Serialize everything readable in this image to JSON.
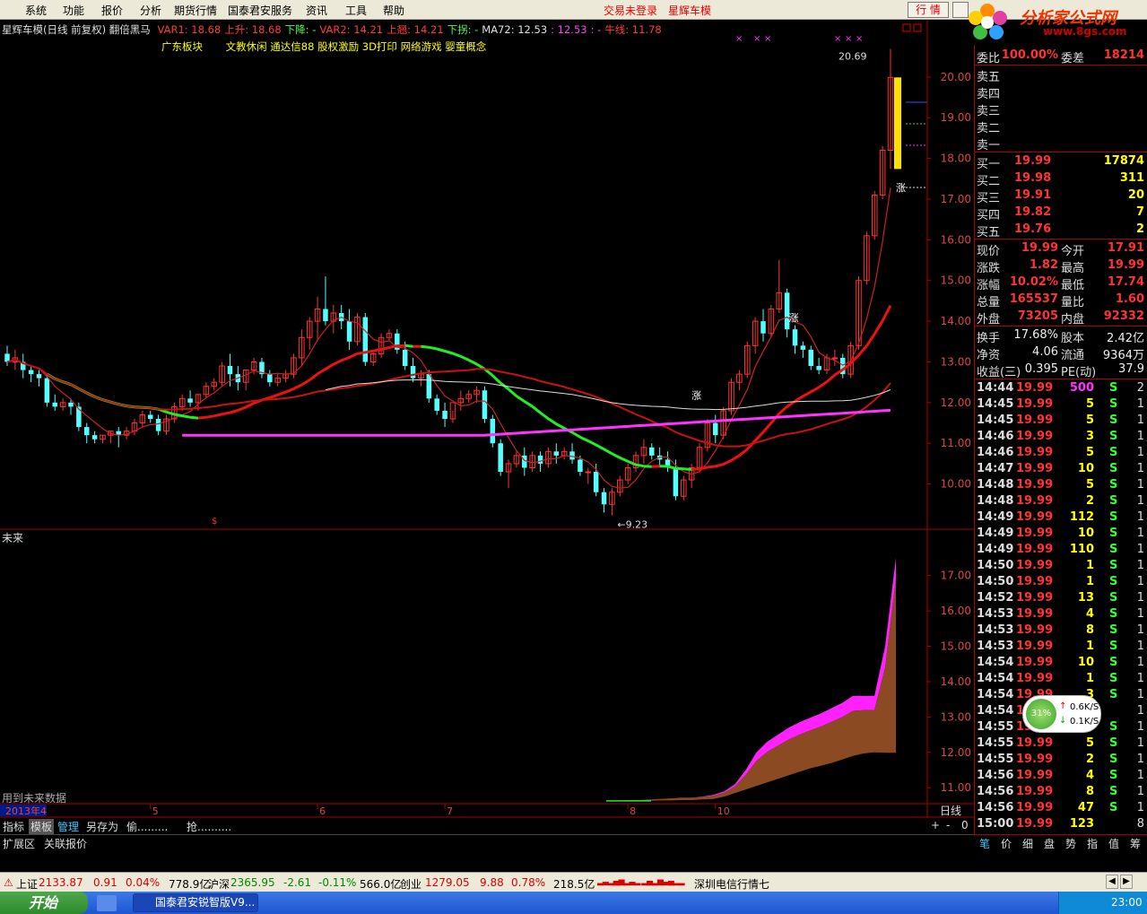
{
  "menu": [
    "系统",
    "功能",
    "报价",
    "分析",
    "期货行情",
    "国泰君安服务",
    "资讯",
    "工具",
    "帮助"
  ],
  "trade_status": "交易未登录",
  "stock_name": "星辉车模",
  "top_buttons": [
    "行 情"
  ],
  "logo": {
    "text": "分析家公式网",
    "url": "www.8gs.com"
  },
  "info": {
    "title": "星辉车模(日线 前复权) 翻倍黑马",
    "items": [
      {
        "label": "VAR1:",
        "value": "18.68",
        "color": "#ff3b3b"
      },
      {
        "label": "上升:",
        "value": "18.68",
        "color": "#ff3b3b"
      },
      {
        "label": "下降:",
        "value": "-",
        "color": "#4cff4c"
      },
      {
        "label": "VAR2:",
        "value": "14.21",
        "color": "#ff3b3b"
      },
      {
        "label": "上翘:",
        "value": "14.21",
        "color": "#ff3b3b"
      },
      {
        "label": "下拐:",
        "value": "-",
        "color": "#4cff4c"
      },
      {
        "label": "MA72:",
        "value": "12.53",
        "color": "#e0e0e0"
      },
      {
        "label": ":",
        "value": "12.53",
        "color": "#ff40ff"
      },
      {
        "label": ":",
        "value": "-",
        "color": "#ff40ff"
      },
      {
        "label": "牛线:",
        "value": "11.78",
        "color": "#ff3b3b"
      }
    ],
    "sector_label": "广东板块",
    "concepts": "文教休闲 通达信88 股权激励 3D打印 网络游戏 婴童概念"
  },
  "chart_data": {
    "type": "candlestick",
    "title": "星辉车模(日线 前复权)",
    "main_ylim": [
      9.0,
      20.9
    ],
    "main_ticks": [
      "20.00",
      "19.00",
      "18.00",
      "17.00",
      "16.00",
      "15.00",
      "14.00",
      "13.00",
      "12.00",
      "11.00",
      "10.00"
    ],
    "sub_ylim": [
      10.6,
      17.5
    ],
    "sub_ticks": [
      "17.00",
      "16.00",
      "15.00",
      "14.00",
      "13.00",
      "12.00",
      "11.00"
    ],
    "sub_title": "未来",
    "sub_note": "用到未来数据",
    "x_axis_labels": [
      {
        "label": "2013年4",
        "index": 0
      },
      {
        "label": "5",
        "index": 18
      },
      {
        "label": "6",
        "index": 39
      },
      {
        "label": "7",
        "index": 55
      },
      {
        "label": "8",
        "index": 78
      },
      {
        "label": "10",
        "index": 89
      }
    ],
    "period_label": "日线",
    "annotations": {
      "high": "20.69",
      "low": "9.23",
      "up_mark": "涨"
    },
    "candles": [
      {
        "o": 13.2,
        "h": 13.4,
        "c": 13.0,
        "l": 12.9
      },
      {
        "o": 13.0,
        "h": 13.3,
        "c": 13.1,
        "l": 12.8
      },
      {
        "o": 13.0,
        "h": 13.2,
        "c": 12.8,
        "l": 12.6
      },
      {
        "o": 12.8,
        "h": 12.9,
        "c": 12.7,
        "l": 12.5
      },
      {
        "o": 12.7,
        "h": 12.8,
        "c": 12.6,
        "l": 12.4
      },
      {
        "o": 12.6,
        "h": 12.7,
        "c": 12.0,
        "l": 11.9
      },
      {
        "o": 12.0,
        "h": 12.2,
        "c": 11.9,
        "l": 11.8
      },
      {
        "o": 11.9,
        "h": 12.1,
        "c": 12.0,
        "l": 11.8
      },
      {
        "o": 12.0,
        "h": 12.1,
        "c": 11.9,
        "l": 11.7
      },
      {
        "o": 11.9,
        "h": 12.0,
        "c": 11.4,
        "l": 11.3
      },
      {
        "o": 11.4,
        "h": 11.5,
        "c": 11.2,
        "l": 11.0
      },
      {
        "o": 11.2,
        "h": 11.3,
        "c": 11.1,
        "l": 11.0
      },
      {
        "o": 11.1,
        "h": 11.2,
        "c": 11.2,
        "l": 11.0
      },
      {
        "o": 11.2,
        "h": 11.3,
        "c": 11.3,
        "l": 11.0
      },
      {
        "o": 11.3,
        "h": 11.4,
        "c": 11.2,
        "l": 10.9
      },
      {
        "o": 11.2,
        "h": 11.4,
        "c": 11.3,
        "l": 11.1
      },
      {
        "o": 11.3,
        "h": 11.6,
        "c": 11.5,
        "l": 11.2
      },
      {
        "o": 11.5,
        "h": 11.8,
        "c": 11.7,
        "l": 11.4
      },
      {
        "o": 11.7,
        "h": 11.8,
        "c": 11.6,
        "l": 11.5
      },
      {
        "o": 11.6,
        "h": 11.7,
        "c": 11.3,
        "l": 11.2
      },
      {
        "o": 11.3,
        "h": 11.7,
        "c": 11.6,
        "l": 11.2
      },
      {
        "o": 11.6,
        "h": 12.0,
        "c": 11.9,
        "l": 11.5
      },
      {
        "o": 11.9,
        "h": 12.2,
        "c": 12.1,
        "l": 11.8
      },
      {
        "o": 12.1,
        "h": 12.3,
        "c": 12.0,
        "l": 11.9
      },
      {
        "o": 12.0,
        "h": 12.2,
        "c": 12.2,
        "l": 11.8
      },
      {
        "o": 12.2,
        "h": 12.5,
        "c": 12.4,
        "l": 12.1
      },
      {
        "o": 12.4,
        "h": 12.6,
        "c": 12.5,
        "l": 12.3
      },
      {
        "o": 12.5,
        "h": 13.0,
        "c": 12.9,
        "l": 12.4
      },
      {
        "o": 12.9,
        "h": 13.2,
        "c": 12.7,
        "l": 12.4
      },
      {
        "o": 12.7,
        "h": 12.9,
        "c": 12.5,
        "l": 12.3
      },
      {
        "o": 12.5,
        "h": 12.8,
        "c": 12.8,
        "l": 12.3
      },
      {
        "o": 12.8,
        "h": 13.1,
        "c": 13.0,
        "l": 12.7
      },
      {
        "o": 13.0,
        "h": 13.1,
        "c": 12.7,
        "l": 12.6
      },
      {
        "o": 12.7,
        "h": 12.8,
        "c": 12.5,
        "l": 12.4
      },
      {
        "o": 12.5,
        "h": 12.7,
        "c": 12.6,
        "l": 12.4
      },
      {
        "o": 12.6,
        "h": 12.8,
        "c": 12.7,
        "l": 12.5
      },
      {
        "o": 12.7,
        "h": 13.2,
        "c": 13.1,
        "l": 12.6
      },
      {
        "o": 13.1,
        "h": 13.8,
        "c": 13.6,
        "l": 12.9
      },
      {
        "o": 13.6,
        "h": 14.1,
        "c": 14.0,
        "l": 13.3
      },
      {
        "o": 14.0,
        "h": 14.6,
        "c": 14.3,
        "l": 13.5
      },
      {
        "o": 14.3,
        "h": 15.1,
        "c": 14.0,
        "l": 13.9
      },
      {
        "o": 14.0,
        "h": 14.4,
        "c": 14.2,
        "l": 13.7
      },
      {
        "o": 14.2,
        "h": 14.4,
        "c": 14.0,
        "l": 13.8
      },
      {
        "o": 14.0,
        "h": 14.3,
        "c": 13.5,
        "l": 13.3
      },
      {
        "o": 13.5,
        "h": 14.2,
        "c": 14.1,
        "l": 13.4
      },
      {
        "o": 14.1,
        "h": 14.2,
        "c": 13.0,
        "l": 12.9
      },
      {
        "o": 13.0,
        "h": 13.3,
        "c": 13.2,
        "l": 12.9
      },
      {
        "o": 13.2,
        "h": 13.7,
        "c": 13.6,
        "l": 13.1
      },
      {
        "o": 13.6,
        "h": 13.8,
        "c": 13.7,
        "l": 13.5
      },
      {
        "o": 13.7,
        "h": 13.8,
        "c": 13.3,
        "l": 13.2
      },
      {
        "o": 13.3,
        "h": 13.5,
        "c": 12.9,
        "l": 12.8
      },
      {
        "o": 12.9,
        "h": 13.1,
        "c": 12.6,
        "l": 12.5
      },
      {
        "o": 12.6,
        "h": 12.8,
        "c": 12.7,
        "l": 12.4
      },
      {
        "o": 12.7,
        "h": 12.8,
        "c": 12.1,
        "l": 12.0
      },
      {
        "o": 12.1,
        "h": 12.2,
        "c": 11.8,
        "l": 11.7
      },
      {
        "o": 11.8,
        "h": 12.0,
        "c": 11.6,
        "l": 11.4
      },
      {
        "o": 11.6,
        "h": 11.8,
        "c": 12.0,
        "l": 11.5
      },
      {
        "o": 12.0,
        "h": 12.3,
        "c": 12.1,
        "l": 11.8
      },
      {
        "o": 12.1,
        "h": 12.3,
        "c": 12.2,
        "l": 12.0
      },
      {
        "o": 12.2,
        "h": 12.4,
        "c": 12.3,
        "l": 12.0
      },
      {
        "o": 12.3,
        "h": 12.4,
        "c": 11.6,
        "l": 11.5
      },
      {
        "o": 11.6,
        "h": 11.7,
        "c": 11.0,
        "l": 10.9
      },
      {
        "o": 11.0,
        "h": 11.1,
        "c": 10.3,
        "l": 10.2
      },
      {
        "o": 10.3,
        "h": 10.6,
        "c": 10.5,
        "l": 9.9
      },
      {
        "o": 10.5,
        "h": 10.8,
        "c": 10.7,
        "l": 10.4
      },
      {
        "o": 10.7,
        "h": 10.9,
        "c": 10.4,
        "l": 10.2
      },
      {
        "o": 10.4,
        "h": 10.8,
        "c": 10.7,
        "l": 10.3
      },
      {
        "o": 10.7,
        "h": 10.8,
        "c": 10.5,
        "l": 10.3
      },
      {
        "o": 10.5,
        "h": 10.9,
        "c": 10.8,
        "l": 10.4
      },
      {
        "o": 10.8,
        "h": 11.0,
        "c": 10.7,
        "l": 10.5
      },
      {
        "o": 10.7,
        "h": 10.9,
        "c": 10.8,
        "l": 10.6
      },
      {
        "o": 10.8,
        "h": 11.0,
        "c": 10.6,
        "l": 10.5
      },
      {
        "o": 10.6,
        "h": 10.7,
        "c": 10.3,
        "l": 10.2
      },
      {
        "o": 10.3,
        "h": 10.4,
        "c": 10.3,
        "l": 10.0
      },
      {
        "o": 10.3,
        "h": 10.5,
        "c": 9.8,
        "l": 9.7
      },
      {
        "o": 9.8,
        "h": 9.9,
        "c": 9.5,
        "l": 9.3
      },
      {
        "o": 9.5,
        "h": 9.9,
        "c": 9.8,
        "l": 9.23
      },
      {
        "o": 9.8,
        "h": 10.2,
        "c": 10.1,
        "l": 9.7
      },
      {
        "o": 10.1,
        "h": 10.5,
        "c": 10.4,
        "l": 10.0
      },
      {
        "o": 10.4,
        "h": 10.8,
        "c": 10.7,
        "l": 10.3
      },
      {
        "o": 10.7,
        "h": 11.1,
        "c": 10.9,
        "l": 10.5
      },
      {
        "o": 10.9,
        "h": 11.0,
        "c": 10.7,
        "l": 10.6
      },
      {
        "o": 10.7,
        "h": 10.9,
        "c": 10.6,
        "l": 10.4
      },
      {
        "o": 10.6,
        "h": 10.8,
        "c": 10.4,
        "l": 10.3
      },
      {
        "o": 10.4,
        "h": 10.6,
        "c": 9.7,
        "l": 9.6
      },
      {
        "o": 9.7,
        "h": 10.2,
        "c": 10.1,
        "l": 9.6
      },
      {
        "o": 10.1,
        "h": 10.5,
        "c": 10.4,
        "l": 9.9
      },
      {
        "o": 10.4,
        "h": 11.0,
        "c": 10.9,
        "l": 10.3
      },
      {
        "o": 10.9,
        "h": 11.6,
        "c": 11.5,
        "l": 10.8
      },
      {
        "o": 11.5,
        "h": 11.7,
        "c": 11.2,
        "l": 11.0
      },
      {
        "o": 11.2,
        "h": 11.9,
        "c": 11.8,
        "l": 11.1
      },
      {
        "o": 11.8,
        "h": 12.6,
        "c": 12.5,
        "l": 11.7
      },
      {
        "o": 12.5,
        "h": 12.8,
        "c": 12.7,
        "l": 12.3
      },
      {
        "o": 12.7,
        "h": 13.5,
        "c": 13.4,
        "l": 12.6
      },
      {
        "o": 13.4,
        "h": 14.1,
        "c": 14.0,
        "l": 13.2
      },
      {
        "o": 14.0,
        "h": 14.3,
        "c": 13.7,
        "l": 13.5
      },
      {
        "o": 13.7,
        "h": 14.4,
        "c": 14.3,
        "l": 13.6
      },
      {
        "o": 14.3,
        "h": 15.5,
        "c": 14.7,
        "l": 14.2
      },
      {
        "o": 14.7,
        "h": 14.8,
        "c": 13.8,
        "l": 13.6
      },
      {
        "o": 13.8,
        "h": 13.9,
        "c": 13.4,
        "l": 13.2
      },
      {
        "o": 13.4,
        "h": 13.5,
        "c": 13.3,
        "l": 13.1
      },
      {
        "o": 13.3,
        "h": 13.4,
        "c": 12.9,
        "l": 12.8
      },
      {
        "o": 12.9,
        "h": 13.1,
        "c": 12.8,
        "l": 12.7
      },
      {
        "o": 12.8,
        "h": 13.2,
        "c": 13.1,
        "l": 12.7
      },
      {
        "o": 13.1,
        "h": 13.3,
        "c": 13.1,
        "l": 12.9
      },
      {
        "o": 13.1,
        "h": 13.2,
        "c": 12.7,
        "l": 12.6
      },
      {
        "o": 12.7,
        "h": 13.5,
        "c": 13.4,
        "l": 12.6
      },
      {
        "o": 13.4,
        "h": 15.1,
        "c": 15.0,
        "l": 13.3
      },
      {
        "o": 15.0,
        "h": 16.2,
        "c": 16.1,
        "l": 14.9
      },
      {
        "o": 16.1,
        "h": 17.2,
        "c": 17.1,
        "l": 16.0
      },
      {
        "o": 17.1,
        "h": 18.3,
        "c": 18.2,
        "l": 17.0
      },
      {
        "o": 18.2,
        "h": 20.69,
        "c": 19.99,
        "l": 17.74
      }
    ],
    "sub_top": [
      10.63,
      10.63,
      10.65,
      10.65,
      10.67,
      10.68,
      10.7,
      10.72,
      10.72,
      10.75,
      10.8,
      10.9,
      11.1,
      11.5,
      12.0,
      12.3,
      12.5,
      12.7,
      12.85,
      12.98,
      13.1,
      13.25,
      13.4,
      13.6,
      13.6,
      13.6,
      15.0,
      17.5
    ],
    "sub_bottom": [
      10.63,
      10.63,
      10.63,
      10.63,
      10.63,
      10.64,
      10.64,
      10.65,
      10.65,
      10.67,
      10.68,
      10.75,
      10.85,
      10.95,
      11.05,
      11.15,
      11.25,
      11.35,
      11.45,
      11.55,
      11.62,
      11.7,
      11.8,
      11.9,
      11.97,
      12.0,
      11.99,
      11.99
    ]
  },
  "right_panel": {
    "header": {
      "label1": "委比",
      "value1": "100.00%",
      "label2": "委差",
      "value2": "18214"
    },
    "sells": [
      {
        "label": "卖五",
        "price": "",
        "vol": ""
      },
      {
        "label": "卖四",
        "price": "",
        "vol": ""
      },
      {
        "label": "卖三",
        "price": "",
        "vol": ""
      },
      {
        "label": "卖二",
        "price": "",
        "vol": ""
      },
      {
        "label": "卖一",
        "price": "",
        "vol": ""
      }
    ],
    "buys": [
      {
        "label": "买一",
        "price": "19.99",
        "vol": "17874"
      },
      {
        "label": "买二",
        "price": "19.98",
        "vol": "311"
      },
      {
        "label": "买三",
        "price": "19.91",
        "vol": "20"
      },
      {
        "label": "买四",
        "price": "19.82",
        "vol": "7"
      },
      {
        "label": "买五",
        "price": "19.76",
        "vol": "2"
      }
    ],
    "quote": [
      {
        "l1": "现价",
        "v1": "19.99",
        "l2": "今开",
        "v2": "17.91"
      },
      {
        "l1": "涨跌",
        "v1": "1.82",
        "l2": "最高",
        "v2": "19.99"
      },
      {
        "l1": "涨幅",
        "v1": "10.02%",
        "l2": "最低",
        "v2": "17.74"
      },
      {
        "l1": "总量",
        "v1": "165537",
        "l2": "量比",
        "v2": "1.60"
      },
      {
        "l1": "外盘",
        "v1": "73205",
        "l2": "内盘",
        "v2": "92332"
      }
    ],
    "fundamentals": [
      {
        "l1": "换手",
        "v1": "17.68%",
        "l2": "股本",
        "v2": "2.42亿"
      },
      {
        "l1": "净资",
        "v1": "4.06",
        "l2": "流通",
        "v2": "9364万"
      },
      {
        "l1": "收益(三)",
        "v1": "0.395",
        "l2": "PE(动)",
        "v2": "37.9"
      }
    ],
    "ticks": [
      {
        "t": "14:44",
        "p": "19.99",
        "v": "500",
        "s": "S",
        "n": "2"
      },
      {
        "t": "14:45",
        "p": "19.99",
        "v": "5",
        "s": "S",
        "n": "1"
      },
      {
        "t": "14:45",
        "p": "19.99",
        "v": "5",
        "s": "S",
        "n": "1"
      },
      {
        "t": "14:46",
        "p": "19.99",
        "v": "3",
        "s": "S",
        "n": "1"
      },
      {
        "t": "14:46",
        "p": "19.99",
        "v": "5",
        "s": "S",
        "n": "1"
      },
      {
        "t": "14:47",
        "p": "19.99",
        "v": "10",
        "s": "S",
        "n": "1"
      },
      {
        "t": "14:48",
        "p": "19.99",
        "v": "5",
        "s": "S",
        "n": "1"
      },
      {
        "t": "14:48",
        "p": "19.99",
        "v": "2",
        "s": "S",
        "n": "1"
      },
      {
        "t": "14:49",
        "p": "19.99",
        "v": "112",
        "s": "S",
        "n": "1"
      },
      {
        "t": "14:49",
        "p": "19.99",
        "v": "10",
        "s": "S",
        "n": "1"
      },
      {
        "t": "14:49",
        "p": "19.99",
        "v": "110",
        "s": "S",
        "n": "1"
      },
      {
        "t": "14:50",
        "p": "19.99",
        "v": "1",
        "s": "S",
        "n": "1"
      },
      {
        "t": "14:50",
        "p": "19.99",
        "v": "1",
        "s": "S",
        "n": "1"
      },
      {
        "t": "14:52",
        "p": "19.99",
        "v": "13",
        "s": "S",
        "n": "1"
      },
      {
        "t": "14:53",
        "p": "19.99",
        "v": "4",
        "s": "S",
        "n": "1"
      },
      {
        "t": "14:53",
        "p": "19.99",
        "v": "8",
        "s": "S",
        "n": "1"
      },
      {
        "t": "14:53",
        "p": "19.99",
        "v": "1",
        "s": "S",
        "n": "1"
      },
      {
        "t": "14:54",
        "p": "19.99",
        "v": "10",
        "s": "S",
        "n": "1"
      },
      {
        "t": "14:54",
        "p": "19.99",
        "v": "1",
        "s": "S",
        "n": "1"
      },
      {
        "t": "14:54",
        "p": "19.99",
        "v": "3",
        "s": "S",
        "n": "1"
      },
      {
        "t": "14:54",
        "p": "19.99",
        "v": "",
        "s": "",
        "n": "1"
      },
      {
        "t": "14:55",
        "p": "19.99",
        "v": "",
        "s": "S",
        "n": "1"
      },
      {
        "t": "14:55",
        "p": "19.99",
        "v": "5",
        "s": "S",
        "n": "1"
      },
      {
        "t": "14:55",
        "p": "19.99",
        "v": "2",
        "s": "S",
        "n": "1"
      },
      {
        "t": "14:56",
        "p": "19.99",
        "v": "4",
        "s": "S",
        "n": "1"
      },
      {
        "t": "14:56",
        "p": "19.99",
        "v": "8",
        "s": "S",
        "n": "1"
      },
      {
        "t": "14:56",
        "p": "19.99",
        "v": "47",
        "s": "S",
        "n": "1"
      },
      {
        "t": "15:00",
        "p": "19.99",
        "v": "123",
        "s": "",
        "n": "8"
      }
    ],
    "tabs": [
      "笔",
      "价",
      "细",
      "盘",
      "势",
      "指",
      "值",
      "筹"
    ]
  },
  "net_widget": {
    "percent": "31%",
    "up": "0.6K/S",
    "down": "0.1K/S"
  },
  "bottom_toolbar": [
    "指标",
    "模板",
    "管理",
    "另存为",
    "偷.........",
    "抢.........."
  ],
  "bottom_toolbar_right": [
    "+",
    "-",
    "0"
  ],
  "ext_bar": [
    "扩展区",
    "关联报价"
  ],
  "status_bar": {
    "sh_label": "上证",
    "sh_val": "2133.87",
    "sh_chg": "0.91",
    "sh_pct": "0.04%",
    "sh_amt": "778.9亿",
    "sz_label": "沪深",
    "sz_val": "2365.95",
    "sz_chg": "-2.61",
    "sz_pct": "-0.11%",
    "sz_amt": "566.0亿",
    "cy_label": "创业",
    "cy_val": "1279.05",
    "cy_chg": "9.88",
    "cy_pct": "0.78%",
    "cy_amt": "218.5亿",
    "news": "深圳电信行情七"
  },
  "taskbar": {
    "start": "开始",
    "app": "国泰君安锐智版V9...",
    "clock": "23:00"
  }
}
